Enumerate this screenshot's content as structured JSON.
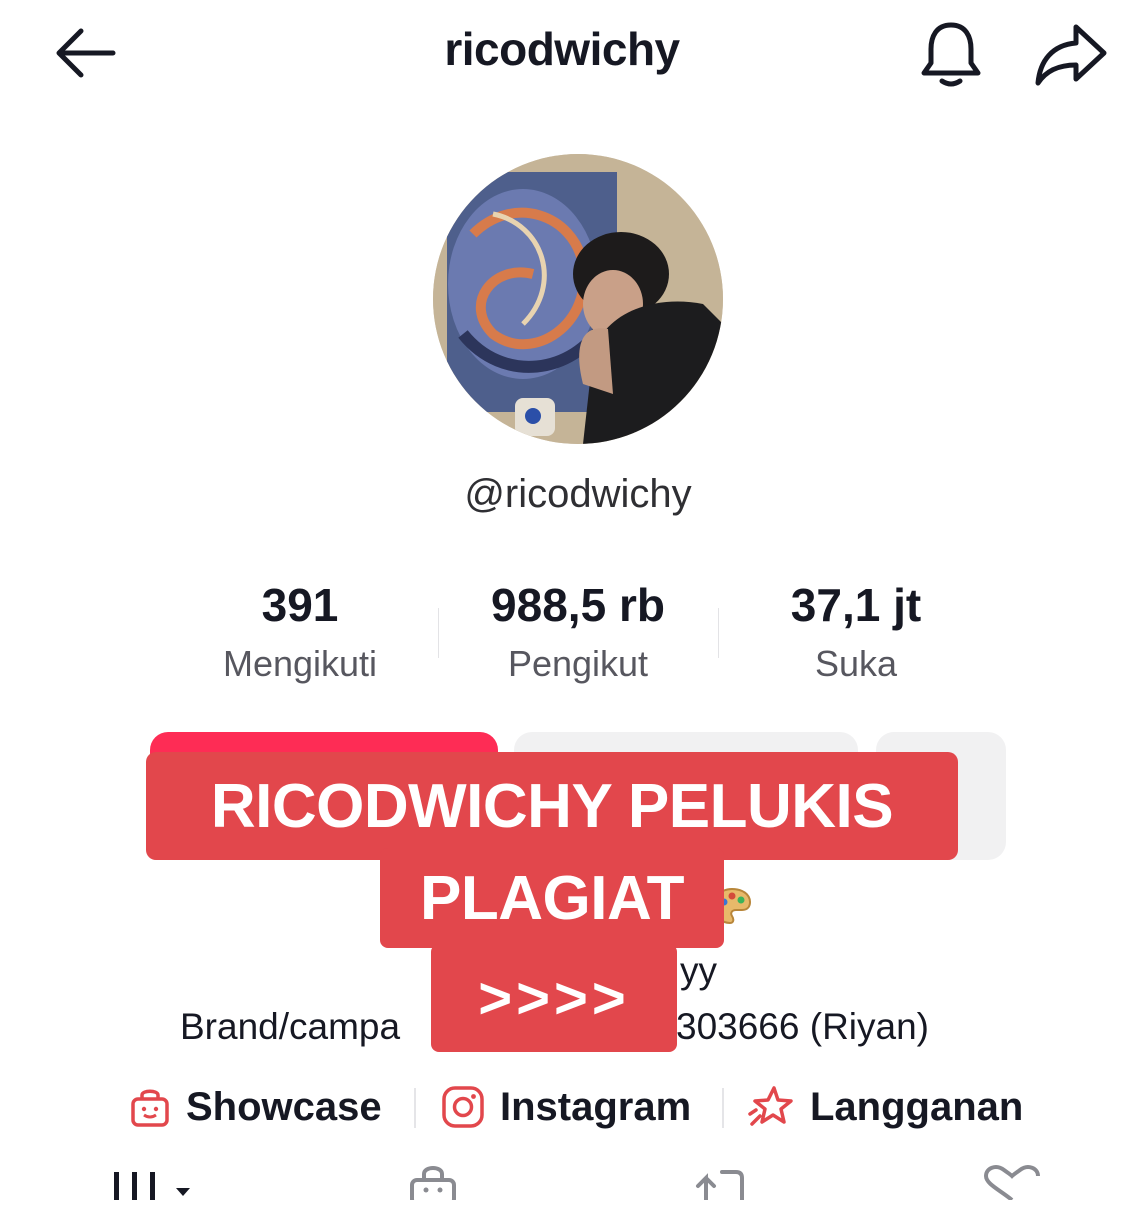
{
  "header": {
    "title": "ricodwichy",
    "back_icon": "arrow-left-icon",
    "bell_icon": "bell-icon",
    "share_icon": "share-arrow-icon"
  },
  "profile": {
    "handle": "@ricodwichy",
    "avatar_icon": "profile-photo"
  },
  "stats": [
    {
      "value": "391",
      "label": "Mengikuti"
    },
    {
      "value": "988,5 rb",
      "label": "Pengikut"
    },
    {
      "value": "37,1 jt",
      "label": "Suka"
    }
  ],
  "overlay": {
    "line1": "RICODWICHY PELUKIS",
    "line2": "PLAGIAT",
    "line3": ">>>>",
    "color": "#e2474c"
  },
  "bio": {
    "line1_tail": "yy",
    "line2_head": "Brand/campa",
    "line2_tail": "303666 (Riyan)"
  },
  "links": [
    {
      "label": "Showcase",
      "icon": "shopping-bag-icon"
    },
    {
      "label": "Instagram",
      "icon": "instagram-icon"
    },
    {
      "label": "Langganan",
      "icon": "star-rocket-icon"
    }
  ],
  "tabs": [
    {
      "icon": "grid-icon"
    },
    {
      "icon": "shop-icon"
    },
    {
      "icon": "repost-icon"
    },
    {
      "icon": "heart-icon"
    }
  ],
  "colors": {
    "accent": "#e2474c",
    "text": "#161823",
    "muted": "#57575f"
  }
}
